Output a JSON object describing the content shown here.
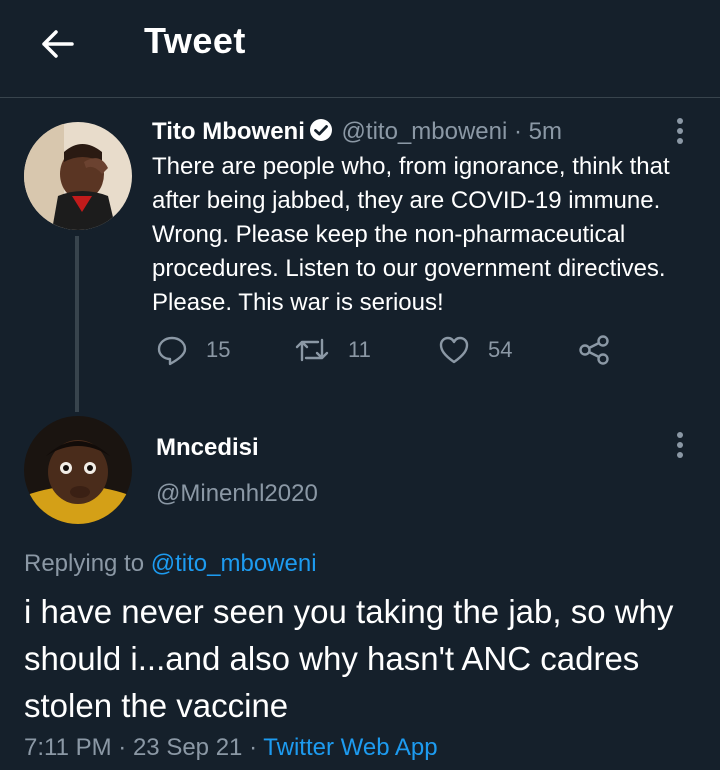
{
  "header": {
    "title": "Tweet"
  },
  "tweet": {
    "author_name": "Tito Mboweni",
    "handle": "@tito_mboweni",
    "separator": "·",
    "time_ago": "5m",
    "text": "There are people who, from ignorance, think that\nafter being jabbed, they are COVID-19 immune.\nWrong. Please keep the non-pharmaceutical\nprocedures. Listen to our government directives.\nPlease. This war is serious!",
    "replies": "15",
    "retweets": "11",
    "likes": "54"
  },
  "reply": {
    "author_name": "Mncedisi",
    "handle": "@Minenhl2020",
    "replying_prefix": "Replying to",
    "replying_to": "@tito_mboweni",
    "text": "i have never seen you taking the jab, so why should i...and also why hasn't ANC cadres stolen the vaccine",
    "time": "7:11 PM",
    "date": "23 Sep 21",
    "dot": "·",
    "source": "Twitter Web App"
  },
  "colors": {
    "background": "#15202b",
    "text": "#ffffff",
    "muted": "#8b98a5",
    "link": "#1d9bf0",
    "divider": "#38444d"
  },
  "icons": [
    "back-arrow-icon",
    "verified-badge-icon",
    "more-options-icon",
    "reply-icon",
    "retweet-icon",
    "like-icon",
    "share-icon"
  ]
}
